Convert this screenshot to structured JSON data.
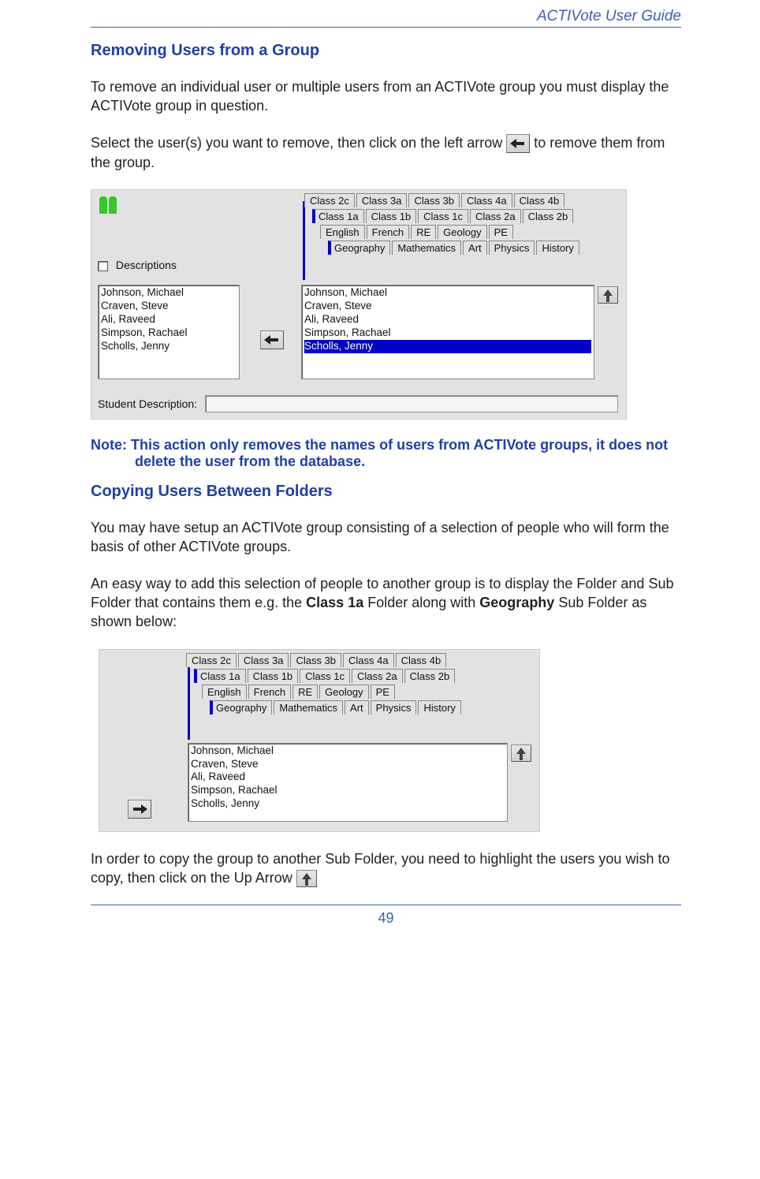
{
  "header": {
    "title": "ACTIVote User Guide"
  },
  "section1": {
    "heading": "Removing Users from a Group",
    "p1": "To remove an individual user or multiple users from an ACTIVote group you must display the ACTIVote group in question.",
    "p2_a": "Select the user(s) you want to remove, then click on the left arrow ",
    "p2_b": " to remove them from the group."
  },
  "note": "Note: This action only removes the names of users from ACTIVote groups, it does not delete the user from the database.",
  "section2": {
    "heading": "Copying Users Between Folders",
    "p1": "You may have setup an ACTIVote group consisting of a selection of people who will form the basis of other ACTIVote groups.",
    "p2_a": "An easy way to add this selection of people to another group is to display the Folder and Sub Folder that contains them e.g. the ",
    "p2_b": "Class 1a",
    "p2_c": " Folder along with ",
    "p2_d": "Geography",
    "p2_e": " Sub Folder as shown below:",
    "p3_a": "In order to copy the group to another Sub Folder, you need to highlight the users you wish to copy, then click on the Up Arrow "
  },
  "screenshot1": {
    "descriptions_label": "Descriptions",
    "student_description_label": "Student Description:",
    "tab_rows": [
      [
        "Class 2c",
        "Class 3a",
        "Class 3b",
        "Class 4a",
        "Class 4b"
      ],
      [
        "Class 1a",
        "Class 1b",
        "Class 1c",
        "Class 2a",
        "Class 2b"
      ],
      [
        "English",
        "French",
        "RE",
        "Geology",
        "PE"
      ],
      [
        "Geography",
        "Mathematics",
        "Art",
        "Physics",
        "History"
      ]
    ],
    "selected_class_tab": "Class 1a",
    "selected_subject_tab": "Geography",
    "left_list": [
      "Johnson, Michael",
      "Craven, Steve",
      "Ali, Raveed",
      "Simpson, Rachael",
      "Scholls, Jenny"
    ],
    "right_list": [
      "Johnson, Michael",
      "Craven, Steve",
      "Ali, Raveed",
      "Simpson, Rachael",
      "Scholls, Jenny"
    ],
    "selected_right_item": "Scholls, Jenny"
  },
  "screenshot2": {
    "tab_rows": [
      [
        "Class 2c",
        "Class 3a",
        "Class 3b",
        "Class 4a",
        "Class 4b"
      ],
      [
        "Class 1a",
        "Class 1b",
        "Class 1c",
        "Class 2a",
        "Class 2b"
      ],
      [
        "English",
        "French",
        "RE",
        "Geology",
        "PE"
      ],
      [
        "Geography",
        "Mathematics",
        "Art",
        "Physics",
        "History"
      ]
    ],
    "selected_class_tab": "Class 1a",
    "selected_subject_tab": "Geography",
    "right_list": [
      "Johnson, Michael",
      "Craven, Steve",
      "Ali, Raveed",
      "Simpson, Rachael",
      "Scholls, Jenny"
    ]
  },
  "page_number": "49"
}
